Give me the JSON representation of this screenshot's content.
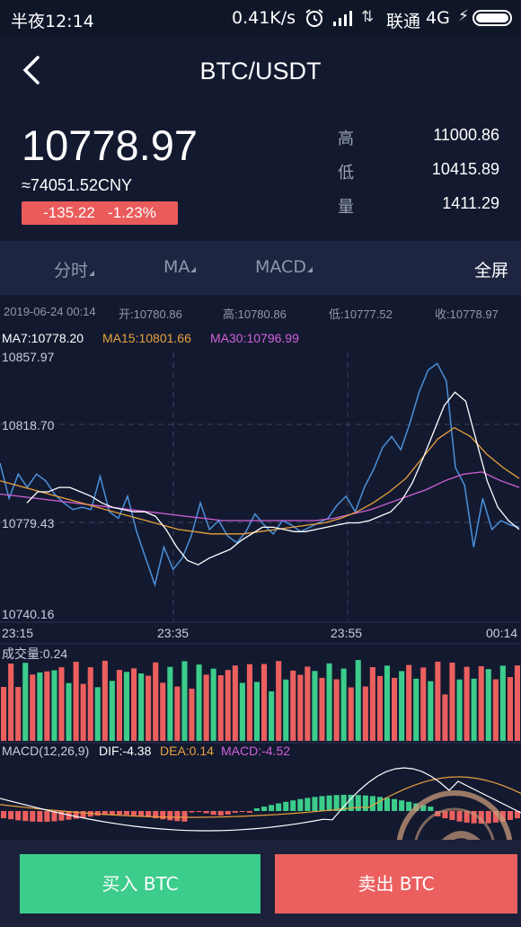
{
  "status_bar": {
    "time": "半夜12:14",
    "net_speed": "0.41K/s",
    "sim_icon": "sim-swap-icon",
    "carrier": "联通",
    "network": "4G"
  },
  "header": {
    "title": "BTC/USDT",
    "back_icon": "back-arrow-icon"
  },
  "ticker": {
    "last_price": "10778.97",
    "cny_price": "≈74051.52CNY",
    "change": "-135.22   -1.23%",
    "stats": [
      {
        "label": "高",
        "value": "11000.86"
      },
      {
        "label": "低",
        "value": "10415.89"
      },
      {
        "label": "量",
        "value": "1411.29"
      }
    ]
  },
  "tabs": {
    "items": [
      {
        "label": "分时"
      },
      {
        "label": "MA"
      },
      {
        "label": "MACD"
      }
    ],
    "fullscreen": "全屏"
  },
  "ohlc": {
    "date": "2019-06-24 00:14",
    "open": "开:10780.86",
    "high": "高:10780.86",
    "low": "低:10777.52",
    "close": "收:10778.97"
  },
  "ma_legend": {
    "ma7": "MA7:10778.20",
    "ma15": "MA15:10801.66",
    "ma30": "MA30:10796.99"
  },
  "price_axis": {
    "top": "10857.97",
    "upper_mid": "10818.70",
    "lower_mid": "10779.43",
    "bottom": "10740.16"
  },
  "time_axis": [
    "23:15",
    "23:35",
    "23:55",
    "00:14"
  ],
  "volume_label": "成交量:0.24",
  "macd_legend": {
    "params": "MACD(12,26,9)",
    "dif": "DIF:-4.38",
    "dea": "DEA:0.14",
    "macd": "MACD:-4.52"
  },
  "colors": {
    "background": "#131a30",
    "up": "#3ccc8b",
    "down": "#eb5f5f",
    "price_line": "#4a90d9",
    "ma7": "#ffffff",
    "ma15": "#e8a13c",
    "ma30": "#d060d8"
  },
  "actions": {
    "buy": "买入 BTC",
    "sell": "卖出 BTC"
  },
  "chart_data": {
    "type": "line",
    "ylim": [
      10740.16,
      10857.97
    ],
    "x_labels": [
      "23:15",
      "23:35",
      "23:55",
      "00:14"
    ],
    "price": [
      10808,
      10792,
      10803,
      10797,
      10803,
      10800,
      10794,
      10790,
      10787,
      10788,
      10787,
      10802,
      10786,
      10783,
      10793,
      10777,
      10765,
      10753,
      10770,
      10760,
      10765,
      10775,
      10790,
      10778,
      10782,
      10775,
      10772,
      10777,
      10785,
      10780,
      10776,
      10782,
      10780,
      10777,
      10779,
      10781,
      10783,
      10789,
      10793,
      10786,
      10797,
      10805,
      10815,
      10820,
      10814,
      10826,
      10840,
      10850,
      10853,
      10845,
      10806,
      10798,
      10770,
      10792,
      10778,
      10782,
      10780,
      10779
    ],
    "ma7": [
      10790,
      10795,
      10795,
      10797,
      10797,
      10795,
      10793,
      10790,
      10788,
      10787,
      10786,
      10786,
      10784,
      10778,
      10770,
      10764,
      10762,
      10765,
      10767,
      10769,
      10773,
      10776,
      10779,
      10779,
      10778,
      10777,
      10777,
      10778,
      10779,
      10780,
      10781,
      10781,
      10782,
      10784,
      10786,
      10791,
      10799,
      10810,
      10822,
      10834,
      10840,
      10836,
      10818,
      10800,
      10788,
      10782,
      10778
    ],
    "ma15": [
      10800,
      10798,
      10796,
      10794,
      10792,
      10790,
      10788,
      10786,
      10784,
      10782,
      10780,
      10778,
      10777,
      10776,
      10776,
      10776,
      10777,
      10778,
      10779,
      10780,
      10781,
      10783,
      10786,
      10790,
      10795,
      10801,
      10810,
      10819,
      10824,
      10820,
      10812,
      10806,
      10801
    ],
    "ma30": [
      10794,
      10793,
      10792,
      10791,
      10790,
      10789,
      10788,
      10787,
      10786,
      10785,
      10784,
      10783,
      10782,
      10782,
      10782,
      10782,
      10782,
      10782,
      10783,
      10785,
      10787,
      10790,
      10793,
      10796,
      10800,
      10803,
      10804,
      10800,
      10797
    ],
    "volume_colors": "alternating up/down bars",
    "macd_dif_last": -4.38,
    "macd_dea_last": 0.14,
    "macd_hist_last": -4.52
  }
}
